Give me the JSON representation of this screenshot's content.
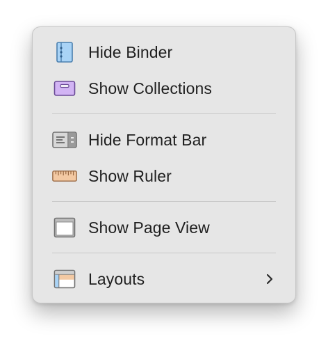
{
  "menu": {
    "items": [
      {
        "label": "Hide Binder",
        "icon": "binder-icon"
      },
      {
        "label": "Show Collections",
        "icon": "collections-icon"
      },
      {
        "label": "Hide Format Bar",
        "icon": "format-bar-icon"
      },
      {
        "label": "Show Ruler",
        "icon": "ruler-icon"
      },
      {
        "label": "Show Page View",
        "icon": "page-view-icon"
      },
      {
        "label": "Layouts",
        "icon": "layouts-icon",
        "submenu_indicator": "chevron-right-icon"
      }
    ]
  },
  "colors": {
    "menu_background": "#e6e6e6",
    "binder_blue": "#a9d3f6",
    "collections_purple": "#d2b4f4",
    "ruler_orange": "#f3c9a3",
    "layouts_orange": "#f3c9a3",
    "text": "#1f1f1f"
  }
}
